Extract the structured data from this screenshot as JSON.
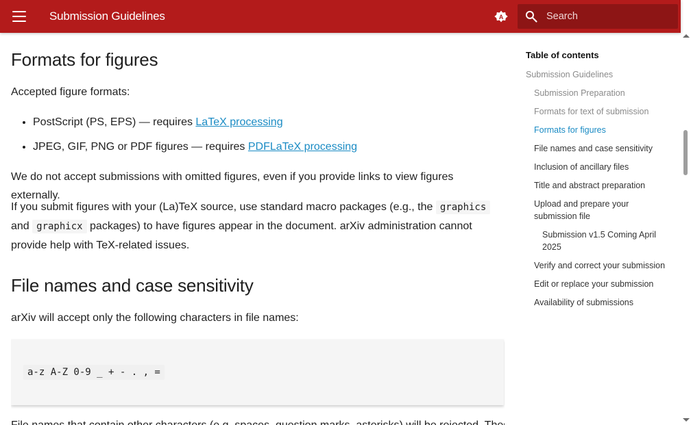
{
  "header": {
    "site_title": "Submission Guidelines",
    "search_placeholder": "Search",
    "theme_letter": "A",
    "color": "#b31b1b"
  },
  "content": {
    "section_figures": {
      "heading": "Formats for figures",
      "intro": "Accepted figure formats:",
      "items": [
        {
          "text": "PostScript (PS, EPS) — requires ",
          "link": "LaTeX processing"
        },
        {
          "text": "JPEG, GIF, PNG or PDF figures — requires ",
          "link": "PDFLaTeX processing"
        }
      ],
      "p1": "We do not accept submissions with omitted figures, even if you provide links to view figures externally.",
      "p2_a": "If you submit figures with your (La)TeX source, use standard macro packages (e.g., the ",
      "p2_code1": "graphics",
      "p2_b": " and ",
      "p2_code2": "graphicx",
      "p2_c": " packages) to have figures appear in the document. arXiv administration cannot provide help with TeX-related issues."
    },
    "section_filenames": {
      "heading": "File names and case sensitivity",
      "intro": "arXiv will accept only the following characters in file names:",
      "code": "a-z A-Z 0-9 _ + - . , =",
      "p_cut": "File names that contain other characters (e.g. spaces, question marks, asterisks) will be rejected. These"
    }
  },
  "toc": {
    "title": "Table of contents",
    "items": [
      {
        "label": "Submission Guidelines"
      },
      {
        "label": "Submission Preparation"
      },
      {
        "label": "Formats for text of submission"
      },
      {
        "label": "Formats for figures"
      },
      {
        "label": "File names and case sensitivity"
      },
      {
        "label": "Inclusion of ancillary files"
      },
      {
        "label": "Title and abstract preparation"
      },
      {
        "label": "Upload and prepare your submission file"
      },
      {
        "label": "Submission v1.5 Coming April 2025"
      },
      {
        "label": "Verify and correct your submission"
      },
      {
        "label": "Edit or replace your submission"
      },
      {
        "label": "Availability of submissions"
      }
    ],
    "active_color": "#1a8bc4"
  }
}
